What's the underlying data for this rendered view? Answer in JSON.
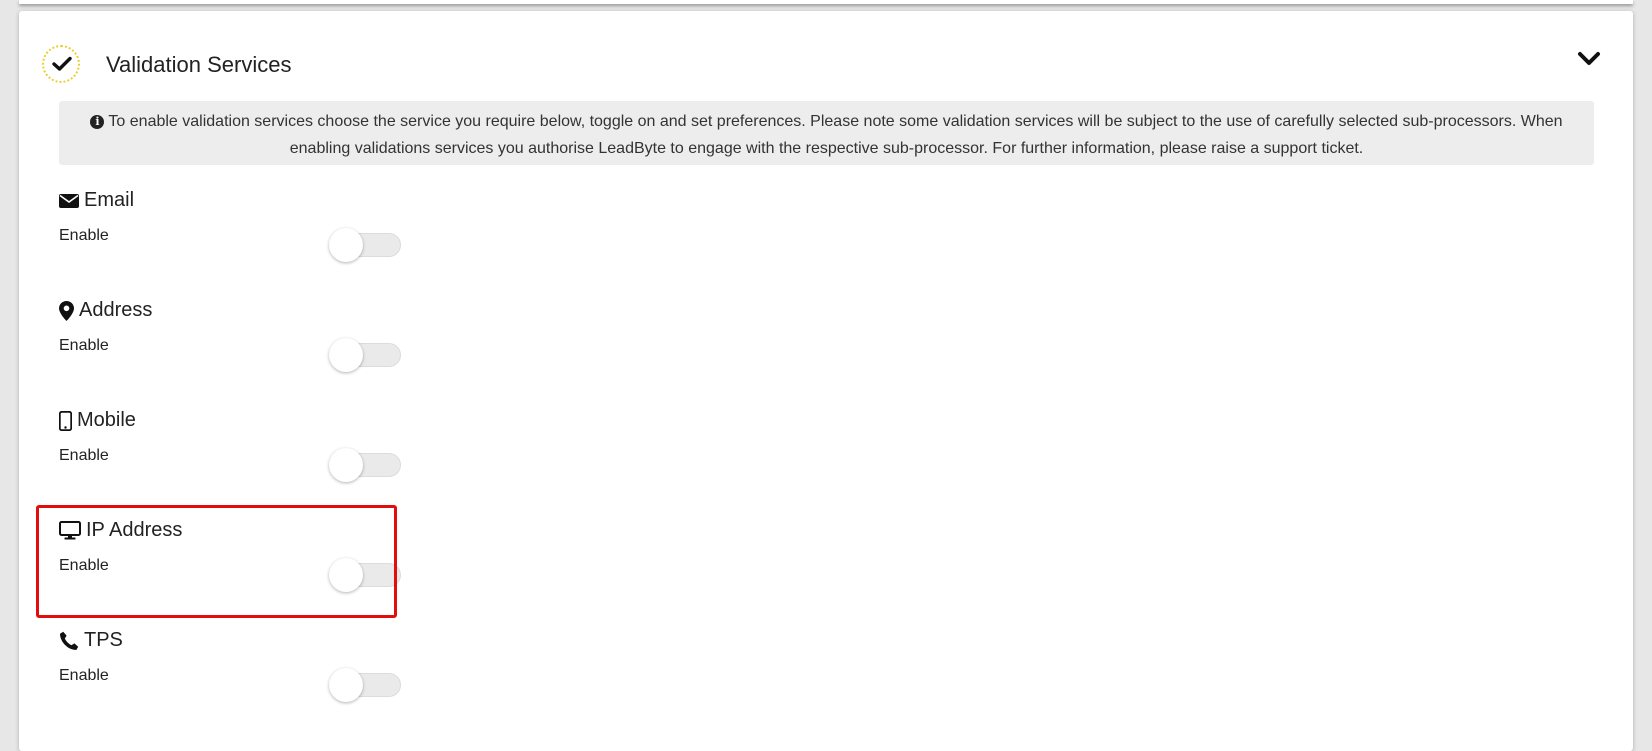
{
  "header": {
    "title": "Validation Services",
    "status_icon": "check-icon",
    "collapse_icon": "chevron-down-icon"
  },
  "notice": {
    "icon": "info-icon",
    "text": "To enable validation services choose the service you require below, toggle on and set preferences. Please note some validation services will be subject to the use of carefully selected sub-processors. When enabling validations services you authorise LeadByte to engage with the respective sub-processor. For further information, please raise a support ticket."
  },
  "services": [
    {
      "title": "Email",
      "icon": "envelope-icon",
      "label": "Enable",
      "enabled": false
    },
    {
      "title": "Address",
      "icon": "map-marker-icon",
      "label": "Enable",
      "enabled": false
    },
    {
      "title": "Mobile",
      "icon": "mobile-icon",
      "label": "Enable",
      "enabled": false
    },
    {
      "title": "IP Address",
      "icon": "desktop-icon",
      "label": "Enable",
      "enabled": false,
      "highlighted": true
    },
    {
      "title": "TPS",
      "icon": "phone-icon",
      "label": "Enable",
      "enabled": false
    }
  ],
  "colors": {
    "accent_dotted": "#e9cf2f",
    "highlight": "#e20e0e",
    "notice_bg": "#ededed"
  }
}
